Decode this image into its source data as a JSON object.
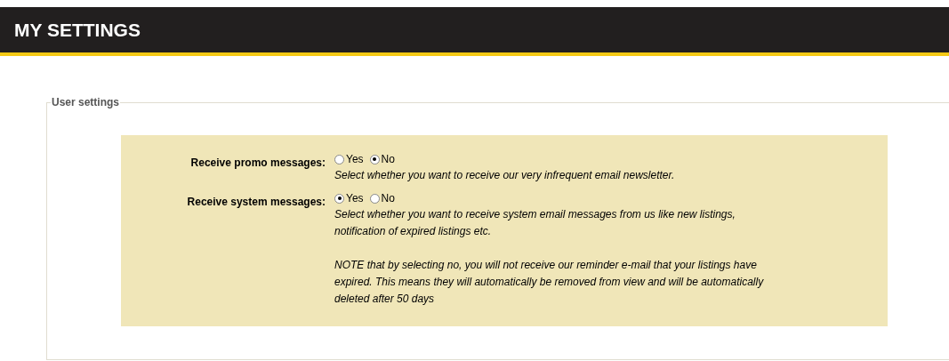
{
  "header": {
    "title": "MY SETTINGS"
  },
  "fieldset": {
    "legend": "User settings",
    "settings": [
      {
        "label": "Receive promo messages:",
        "options": [
          {
            "label": "Yes",
            "selected": false
          },
          {
            "label": "No",
            "selected": true
          }
        ],
        "description": [
          "Select whether you want to receive our very infrequent email newsletter."
        ]
      },
      {
        "label": "Receive system messages:",
        "options": [
          {
            "label": "Yes",
            "selected": true
          },
          {
            "label": "No",
            "selected": false
          }
        ],
        "description": [
          "Select whether you want to receive system email messages from us like new listings, notification of expired listings etc.",
          "NOTE that by selecting no, you will not receive our reminder e-mail that your listings have expired. This means they will automatically be removed from view and will be automatically deleted after 50 days"
        ]
      }
    ]
  }
}
